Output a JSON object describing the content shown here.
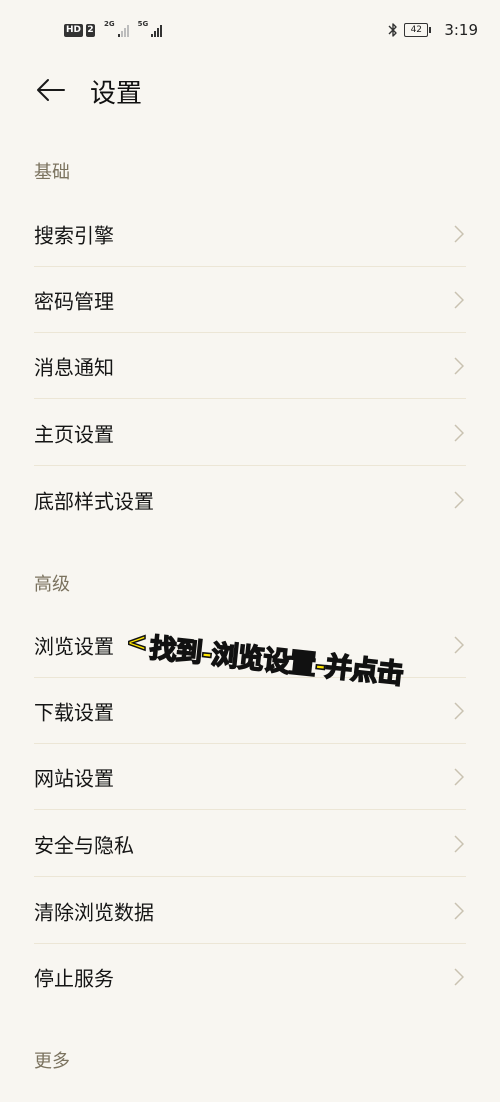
{
  "status_bar": {
    "hd": "HD",
    "sim": "2",
    "gen_1": "2G",
    "gen_2": "5G",
    "battery": "42",
    "time": "3:19"
  },
  "header": {
    "title": "设置"
  },
  "sections": {
    "basic": {
      "title": "基础",
      "items": [
        "搜索引擎",
        "密码管理",
        "消息通知",
        "主页设置",
        "底部样式设置"
      ]
    },
    "advanced": {
      "title": "高级",
      "items": [
        "浏览设置",
        "下载设置",
        "网站设置",
        "安全与隐私",
        "清除浏览数据",
        "停止服务"
      ]
    },
    "more": {
      "title": "更多"
    }
  },
  "annotation": {
    "arrow": "<",
    "text": "找到-浏览设置-并点击"
  },
  "colors": {
    "background": "#f8f6f1",
    "section_title": "#7b735f",
    "divider": "#ece6d6",
    "annotation_fill": "#ffe600"
  },
  "icons": {
    "back": "arrow-left-icon",
    "chevron": "chevron-right-icon",
    "bluetooth": "bluetooth-icon",
    "battery": "battery-icon",
    "signal": "signal-bars-icon"
  }
}
